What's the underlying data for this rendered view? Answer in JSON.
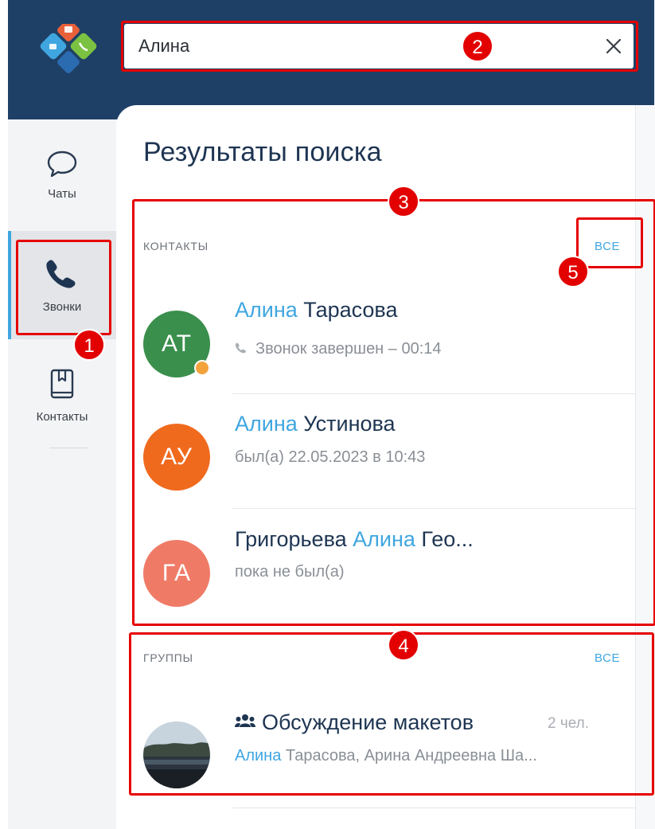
{
  "search": {
    "value": "Алина"
  },
  "sidebar": {
    "items": [
      {
        "label": "Чаты",
        "icon": "chat-bubble-icon"
      },
      {
        "label": "Звонки",
        "icon": "phone-icon",
        "active": true
      },
      {
        "label": "Контакты",
        "icon": "contacts-book-icon"
      }
    ]
  },
  "results": {
    "title": "Результаты поиска",
    "contacts": {
      "label": "контакты",
      "all_label": "все",
      "items": [
        {
          "initials": "АТ",
          "avatar_color": "#3a8f4c",
          "name_hl": "Алина",
          "name_rest": " Тарасова",
          "sub": "Звонок завершен – 00:14",
          "status": "away"
        },
        {
          "initials": "АУ",
          "avatar_color": "#f06a1e",
          "name_hl": "Алина",
          "name_rest": " Устинова",
          "sub": "был(а) 22.05.2023 в 10:43"
        },
        {
          "initials": "ГА",
          "avatar_color": "#ef7b67",
          "name_pre": "Григорьева ",
          "name_hl": "Алина",
          "name_rest": " Гео...",
          "sub": "пока не был(а)"
        }
      ]
    },
    "groups": {
      "label": "группы",
      "all_label": "все",
      "items": [
        {
          "name": "Обсуждение макетов",
          "count": "2 чел.",
          "members_hl": "Алина",
          "members_rest": " Тарасова, Арина Андреевна Ша...",
          "icon": "group-icon"
        }
      ]
    }
  },
  "annotations": [
    "1",
    "2",
    "3",
    "4",
    "5"
  ],
  "colors": {
    "header": "#1f4066",
    "accent": "#3fa6e0",
    "annotation": "#e60000",
    "title": "#1e3552"
  }
}
